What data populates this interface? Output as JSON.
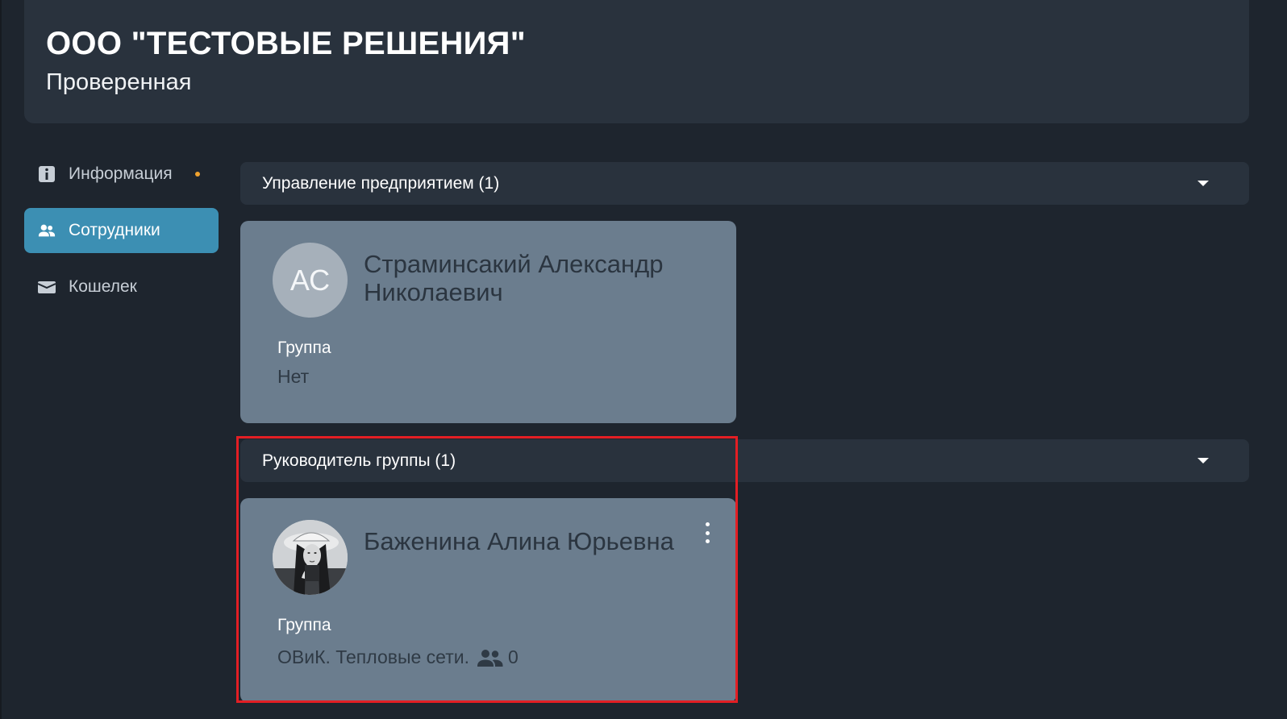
{
  "header": {
    "org_name": "ООО \"ТЕСТОВЫЕ РЕШЕНИЯ\"",
    "status": "Проверенная"
  },
  "sidebar": {
    "items": [
      {
        "label": "Информация",
        "icon": "info-icon",
        "active": false,
        "has_dot": true
      },
      {
        "label": "Сотрудники",
        "icon": "people-icon",
        "active": true
      },
      {
        "label": "Кошелек",
        "icon": "wallet-icon",
        "active": false
      }
    ]
  },
  "sections": [
    {
      "title": "Управление предприятием (1)",
      "employees": [
        {
          "initials": "АС",
          "name": "Страминсакий Александр Николаевич",
          "group_label": "Группа",
          "group_value": "Нет"
        }
      ]
    },
    {
      "title": "Руководитель группы (1)",
      "employees": [
        {
          "avatar": "photo",
          "name": "Баженина Алина Юрьевна",
          "group_label": "Группа",
          "group_value": "ОВиК. Тепловые сети.",
          "members_count": "0"
        }
      ]
    }
  ],
  "colors": {
    "background": "#1e252e",
    "panel": "#29323d",
    "card": "#6b7d8e",
    "accent": "#3c8fb3",
    "notification_dot": "#f0a22e",
    "highlight": "#e31e24"
  }
}
